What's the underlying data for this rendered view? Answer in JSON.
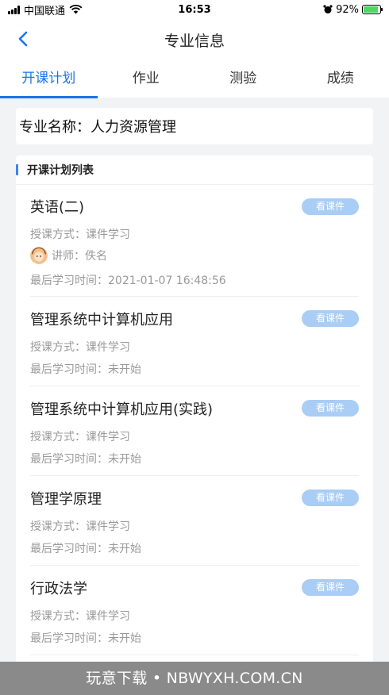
{
  "status_bar": {
    "carrier": "中国联通",
    "time": "16:53",
    "battery": "92%",
    "battery_level": 0.92
  },
  "nav": {
    "title": "专业信息"
  },
  "tabs": [
    {
      "label": "开课计划"
    },
    {
      "label": "作业"
    },
    {
      "label": "测验"
    },
    {
      "label": "成绩"
    }
  ],
  "major": {
    "label": "专业名称：",
    "value": "人力资源管理"
  },
  "plan_list": {
    "title": "开课计划列表",
    "button_label": "看课件",
    "courses": [
      {
        "name": "英语(二)",
        "mode": "授课方式：课件学习",
        "teacher": "讲师：佚名",
        "last_study": "最后学习时间：2021-01-07 16:48:56"
      },
      {
        "name": "管理系统中计算机应用",
        "mode": "授课方式：课件学习",
        "last_study": "最后学习时间：未开始"
      },
      {
        "name": "管理系统中计算机应用(实践)",
        "mode": "授课方式：课件学习",
        "last_study": "最后学习时间：未开始"
      },
      {
        "name": "管理学原理",
        "mode": "授课方式：课件学习",
        "last_study": "最后学习时间：未开始"
      },
      {
        "name": "行政法学",
        "mode": "授课方式：课件学习",
        "last_study": "最后学习时间：未开始"
      }
    ]
  },
  "watermark": "玩意下载 • NBWYXH.COM.CN",
  "colors": {
    "accent": "#1a73e8",
    "button": "#a9cdf4",
    "background": "#f2f3f5"
  }
}
